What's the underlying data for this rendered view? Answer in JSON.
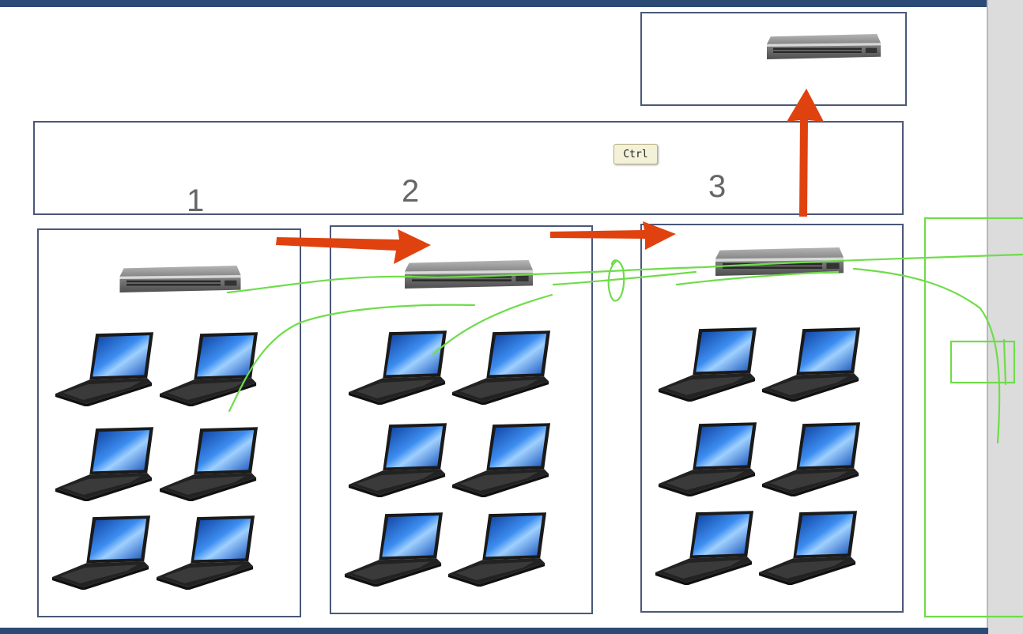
{
  "diagram": {
    "switch_groups": [
      {
        "label": "1",
        "laptop_count": 6
      },
      {
        "label": "2",
        "laptop_count": 6
      },
      {
        "label": "3",
        "laptop_count": 6
      }
    ],
    "core_switch_label": "",
    "key_tooltip": "Ctrl",
    "colors": {
      "frame": "#2b4a74",
      "box_border": "#4a5878",
      "arrow": "#e0420f",
      "annotation": "#6fdc4a",
      "screen": "#1f6fd1",
      "switch_body": "#7b7b7b"
    }
  }
}
